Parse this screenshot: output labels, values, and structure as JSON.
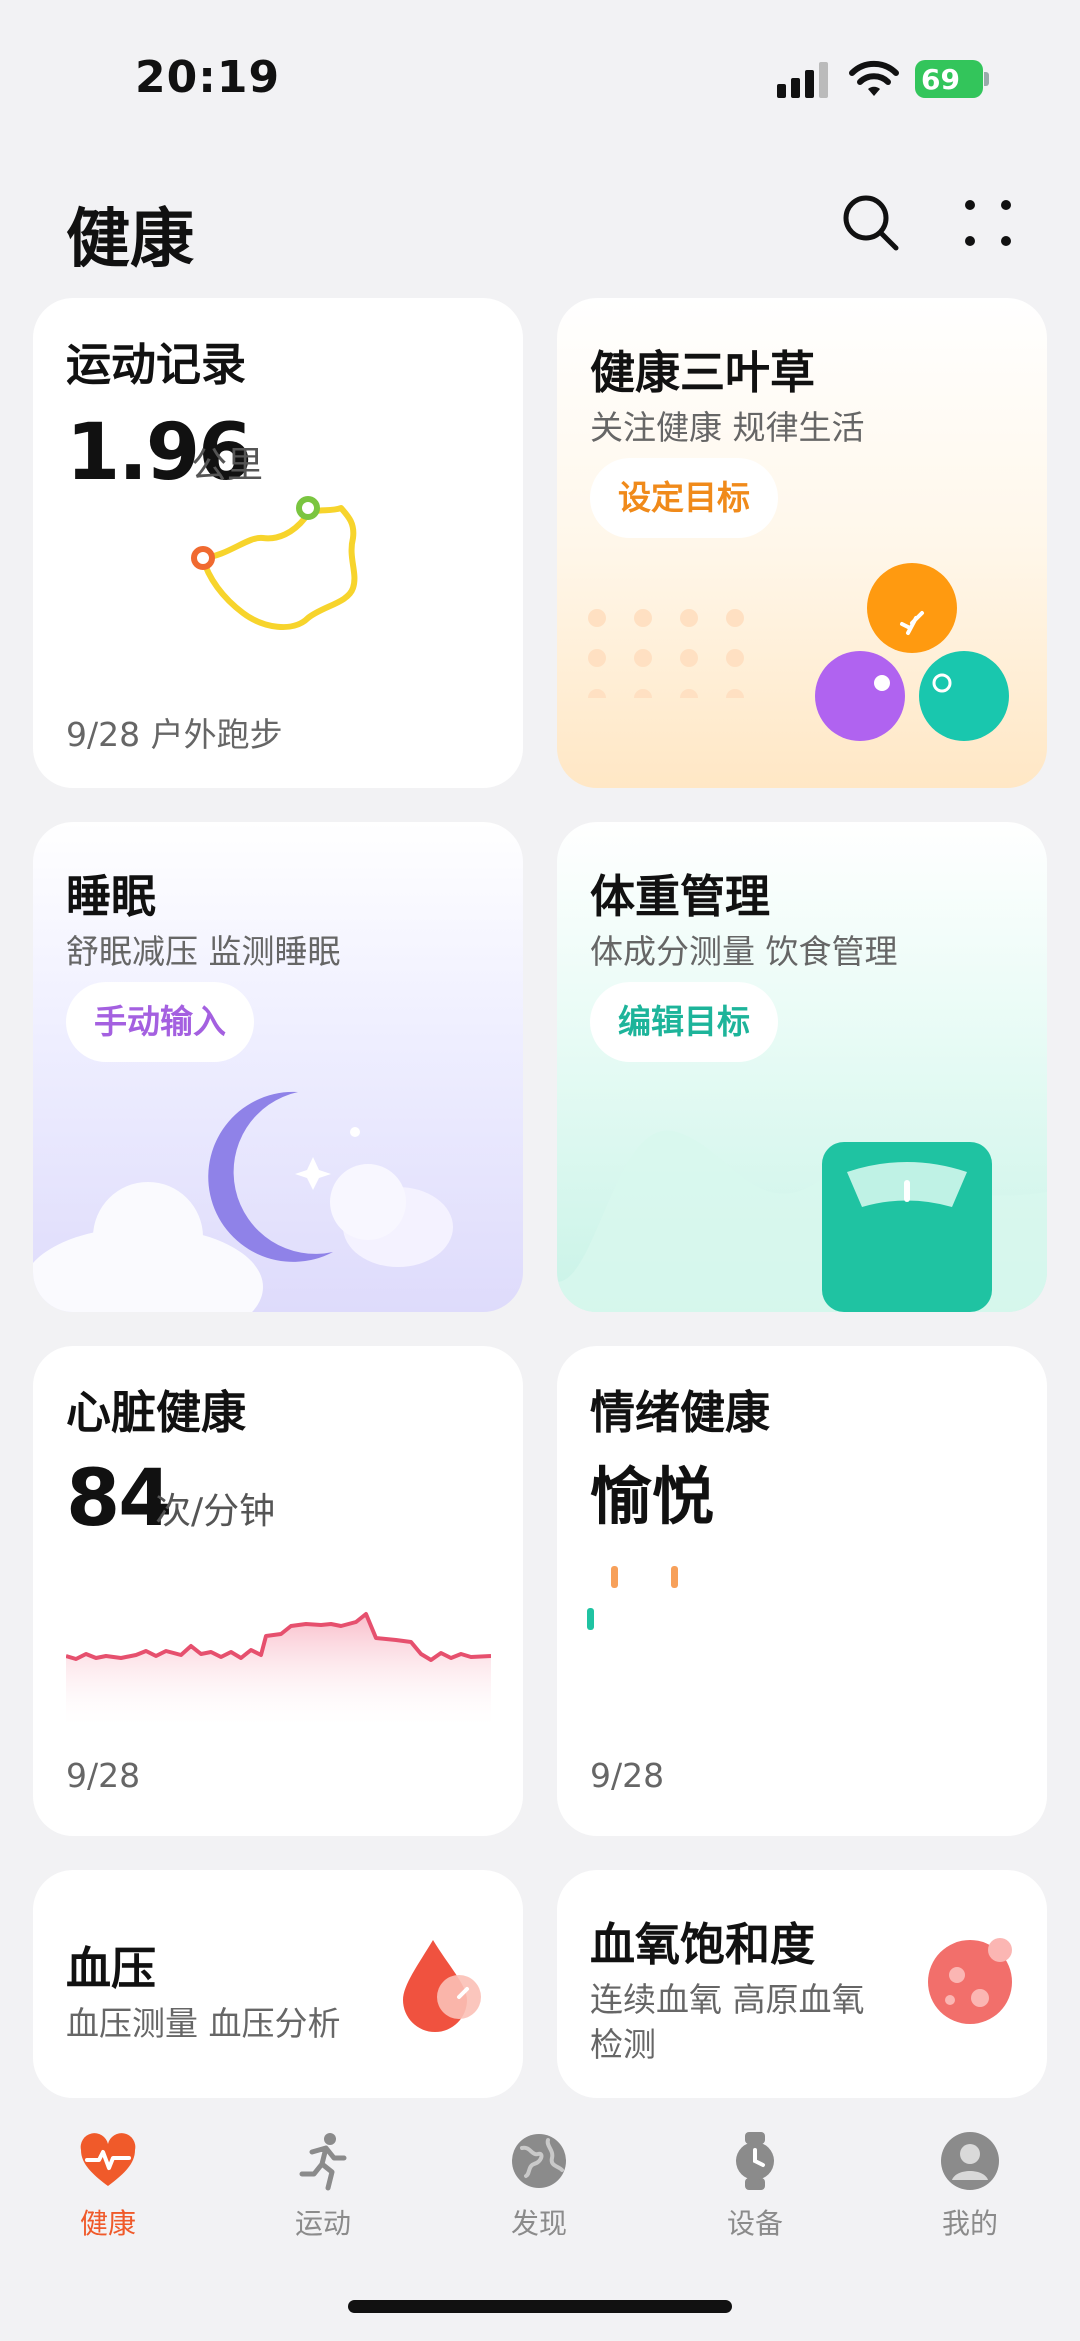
{
  "status_bar": {
    "time": "20:19",
    "battery": "69"
  },
  "header": {
    "title": "健康"
  },
  "cards": {
    "run": {
      "title": "运动记录",
      "value": "1.96",
      "unit": "公里",
      "date": "9/28 户外跑步"
    },
    "clover": {
      "title": "健康三叶草",
      "subtitle": "关注健康 规律生活",
      "button": "设定目标"
    },
    "sleep": {
      "title": "睡眠",
      "subtitle": "舒眠减压 监测睡眠",
      "button": "手动输入"
    },
    "weight": {
      "title": "体重管理",
      "subtitle": "体成分测量 饮食管理",
      "button": "编辑目标"
    },
    "heart": {
      "title": "心脏健康",
      "value": "84",
      "unit": "次/分钟",
      "date": "9/28"
    },
    "mood": {
      "title": "情绪健康",
      "value": "愉悦",
      "date": "9/28"
    },
    "bp": {
      "title": "血压",
      "subtitle": "血压测量 血压分析"
    },
    "spo2": {
      "title": "血氧饱和度",
      "subtitle_line1": "连续血氧 高原血氧",
      "subtitle_line2": "检测"
    }
  },
  "nav": [
    {
      "label": "健康",
      "icon": "heart-pulse-icon",
      "active": true
    },
    {
      "label": "运动",
      "icon": "running-icon",
      "active": false
    },
    {
      "label": "发现",
      "icon": "globe-icon",
      "active": false
    },
    {
      "label": "设备",
      "icon": "watch-icon",
      "active": false
    },
    {
      "label": "我的",
      "icon": "profile-icon",
      "active": false
    }
  ],
  "colors": {
    "accent": "#f05a2a",
    "clover_button": "#f08a1a",
    "sleep_button": "#a460e0",
    "weight_button": "#1db49a",
    "heart_line": "#e6506e"
  }
}
